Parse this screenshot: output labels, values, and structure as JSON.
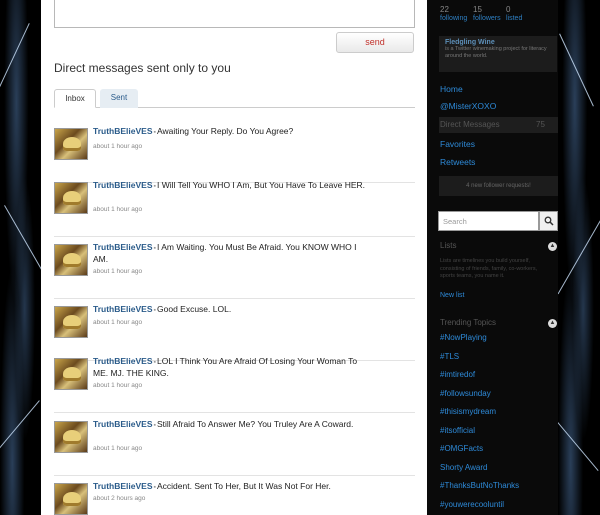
{
  "compose": {
    "send_label": "send"
  },
  "heading": "Direct messages sent only to you",
  "tabs": [
    {
      "label": "Inbox"
    },
    {
      "label": "Sent"
    }
  ],
  "messages": [
    {
      "sender": "TruthBElieVES",
      "text": "Awaiting Your Reply. Do You Agree?",
      "time": "about 1 hour ago"
    },
    {
      "sender": "TruthBElieVES",
      "text": "I Will Tell You WHO I Am, But You Have To Leave HER.",
      "time": "about 1 hour ago"
    },
    {
      "sender": "TruthBElieVES",
      "text": "I Am Waiting. You Must Be Afraid. You KNOW WHO I AM.",
      "time": "about 1 hour ago"
    },
    {
      "sender": "TruthBElieVES",
      "text": "Good Excuse. LOL.",
      "time": "about 1 hour ago"
    },
    {
      "sender": "TruthBElieVES",
      "text": "LOL I Think You Are Afraid Of Losing Your Woman To ME. MJ. THE KING.",
      "time": "about 1 hour ago"
    },
    {
      "sender": "TruthBElieVES",
      "text": "Still Afraid To Answer Me? You Truley Are A Coward.",
      "time": "about 1 hour ago"
    },
    {
      "sender": "TruthBElieVES",
      "text": "Accident. Sent To Her, But It Was Not For Her.",
      "time": "about 2 hours ago"
    }
  ],
  "sidebar": {
    "stats": [
      {
        "num": "22",
        "label": "following"
      },
      {
        "num": "15",
        "label": "followers"
      },
      {
        "num": "0",
        "label": "listed"
      }
    ],
    "promo": {
      "title": "Fledgling Wine",
      "body": "is a Twitter winemaking project for literacy around the world."
    },
    "nav": {
      "home": "Home",
      "mention": "@MisterXOXO",
      "direct": "Direct Messages",
      "direct_count": "75",
      "favorites": "Favorites",
      "retweets": "Retweets"
    },
    "follower_requests": "4 new follower requests!",
    "search_placeholder": "Search",
    "lists": {
      "title": "Lists",
      "desc": "Lists are timelines you build yourself, consisting of friends, family, co-workers, sports teams, you name it.",
      "new_list": "New list"
    },
    "trending": {
      "title": "Trending Topics",
      "items": [
        "#NowPlaying",
        "#TLS",
        "#imtiredof",
        "#followsunday",
        "#thisismydream",
        "#itsofficial",
        "#OMGFacts",
        "Shorty Award",
        "#ThanksButNoThanks",
        "#youwerecooluntil"
      ]
    }
  }
}
